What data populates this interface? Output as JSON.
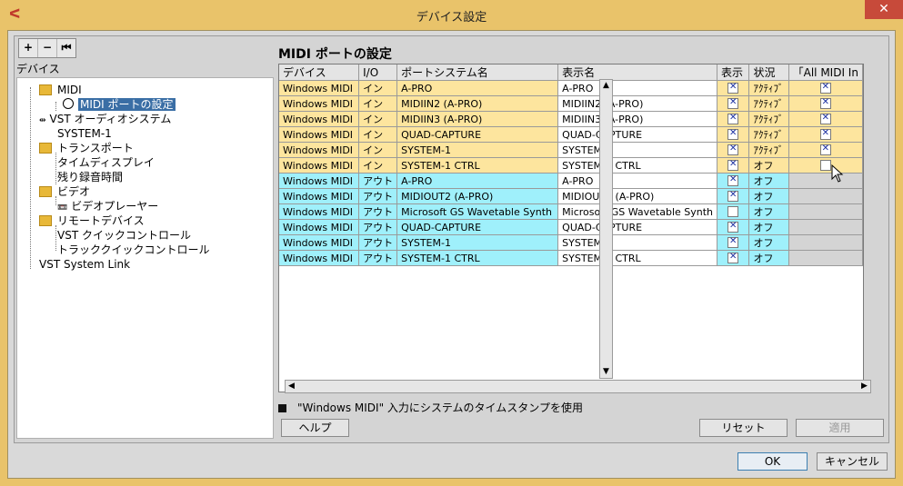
{
  "window": {
    "title": "デバイス設定",
    "close": "✕"
  },
  "toolbar": {
    "add": "+",
    "remove": "−",
    "reset": "⏮"
  },
  "left_panel": {
    "label": "デバイス"
  },
  "tree": [
    {
      "label": "MIDI"
    },
    {
      "label": "MIDI ポートの設定"
    },
    {
      "label": "VST オーディオシステム"
    },
    {
      "label": "SYSTEM-1"
    },
    {
      "label": "トランスポート"
    },
    {
      "label": "タイムディスプレイ"
    },
    {
      "label": "残り録音時間"
    },
    {
      "label": "ビデオ"
    },
    {
      "label": "ビデオプレーヤー"
    },
    {
      "label": "リモートデバイス"
    },
    {
      "label": "VST クイックコントロール"
    },
    {
      "label": "トラッククイックコントロール"
    },
    {
      "label": "VST System Link"
    }
  ],
  "right_panel": {
    "title": "MIDI ポートの設定"
  },
  "columns": [
    "デバイス",
    "I/O",
    "ポートシステム名",
    "表示名",
    "表示",
    "状況",
    "「All MIDI In"
  ],
  "rows": [
    {
      "device": "Windows MIDI",
      "io": "イン",
      "port": "A-PRO",
      "display": "A-PRO",
      "visible": true,
      "status": "ｱｸﾃｨﾌﾞ",
      "allmidi": true
    },
    {
      "device": "Windows MIDI",
      "io": "イン",
      "port": "MIDIIN2 (A-PRO)",
      "display": "MIDIIN2 (A-PRO)",
      "visible": true,
      "status": "ｱｸﾃｨﾌﾞ",
      "allmidi": true
    },
    {
      "device": "Windows MIDI",
      "io": "イン",
      "port": "MIDIIN3 (A-PRO)",
      "display": "MIDIIN3 (A-PRO)",
      "visible": true,
      "status": "ｱｸﾃｨﾌﾞ",
      "allmidi": true
    },
    {
      "device": "Windows MIDI",
      "io": "イン",
      "port": "QUAD-CAPTURE",
      "display": "QUAD-CAPTURE",
      "visible": true,
      "status": "ｱｸﾃｨﾌﾞ",
      "allmidi": true
    },
    {
      "device": "Windows MIDI",
      "io": "イン",
      "port": "SYSTEM-1",
      "display": "SYSTEM-1",
      "visible": true,
      "status": "ｱｸﾃｨﾌﾞ",
      "allmidi": true
    },
    {
      "device": "Windows MIDI",
      "io": "イン",
      "port": "SYSTEM-1 CTRL",
      "display": "SYSTEM-1 CTRL",
      "visible": true,
      "status": "オフ",
      "allmidi": false
    },
    {
      "device": "Windows MIDI",
      "io": "アウト",
      "port": "A-PRO",
      "display": "A-PRO",
      "visible": true,
      "status": "オフ",
      "allmidi": null
    },
    {
      "device": "Windows MIDI",
      "io": "アウト",
      "port": "MIDIOUT2 (A-PRO)",
      "display": "MIDIOUT2 (A-PRO)",
      "visible": true,
      "status": "オフ",
      "allmidi": null
    },
    {
      "device": "Windows MIDI",
      "io": "アウト",
      "port": "Microsoft GS Wavetable Synth",
      "display": "Microsoft GS Wavetable Synth",
      "visible": false,
      "status": "オフ",
      "allmidi": null
    },
    {
      "device": "Windows MIDI",
      "io": "アウト",
      "port": "QUAD-CAPTURE",
      "display": "QUAD-CAPTURE",
      "visible": true,
      "status": "オフ",
      "allmidi": null
    },
    {
      "device": "Windows MIDI",
      "io": "アウト",
      "port": "SYSTEM-1",
      "display": "SYSTEM-1",
      "visible": true,
      "status": "オフ",
      "allmidi": null
    },
    {
      "device": "Windows MIDI",
      "io": "アウト",
      "port": "SYSTEM-1 CTRL",
      "display": "SYSTEM-1 CTRL",
      "visible": true,
      "status": "オフ",
      "allmidi": null
    }
  ],
  "option": {
    "label": "\"Windows MIDI\" 入力にシステムのタイムスタンプを使用"
  },
  "buttons": {
    "help": "ヘルプ",
    "reset": "リセット",
    "apply": "適用",
    "ok": "OK",
    "cancel": "キャンセル"
  },
  "colors": {
    "in_row": "#fde59e",
    "out_row": "#9ff0fb",
    "title_bar": "#e9c36a",
    "close": "#c74a3a"
  }
}
